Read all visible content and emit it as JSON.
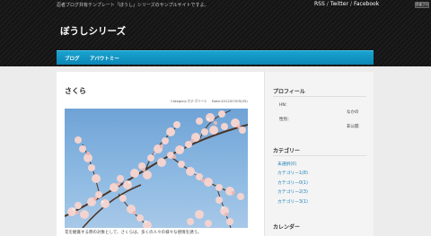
{
  "header": {
    "tagline": "忍者ブログ共有テンプレート「ぼうし」シリーズのサンプルサイトですよ。",
    "links": [
      "RSS",
      "Twitter",
      "Facebook"
    ],
    "link_separator": "/",
    "badge": "忍者ブログ",
    "site_title": "ぼうしシリーズ"
  },
  "nav": {
    "items": [
      "ブログ",
      "アバウトミー"
    ]
  },
  "post": {
    "title": "さくら",
    "category_label": "Category:カテゴリー2",
    "date_label": "Date:2012/07/05(05)",
    "image_icon": "cherry-blossom-photo",
    "excerpt": "花を観賞する際の対象として、さくらは、多くの人々の様々な感情を誘う。"
  },
  "sidebar": {
    "profile": {
      "heading": "プロフィール",
      "hn_label": "HN：",
      "hn_value": "なかの",
      "gender_label": "性別：",
      "gender_value": "非公開"
    },
    "categories": {
      "heading": "カテゴリー",
      "items": [
        "未選択(0)",
        "カテゴリー1(8)",
        "カテゴリー0(1)",
        "カテゴリー2(3)",
        "カテゴリー3(1)"
      ]
    },
    "calendar": {
      "heading": "カレンダー"
    }
  },
  "colors": {
    "header_bg": "#181818",
    "nav_blue": "#0b86b5",
    "link_blue": "#1a7fb6",
    "page_bg": "#ececec"
  }
}
